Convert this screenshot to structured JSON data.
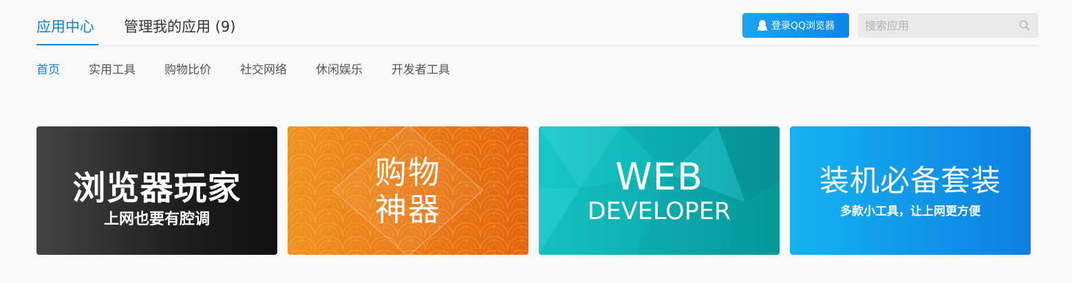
{
  "header": {
    "tabs": [
      {
        "label": "应用中心",
        "active": true
      },
      {
        "label": "管理我的应用 (9)",
        "active": false
      }
    ],
    "login_button": {
      "label": "登录QQ浏览器",
      "icon": "qq-penguin-icon"
    },
    "search": {
      "placeholder": "搜索应用",
      "value": "",
      "icon": "search-icon"
    }
  },
  "categories": [
    {
      "label": "首页",
      "active": true
    },
    {
      "label": "实用工具",
      "active": false
    },
    {
      "label": "购物比价",
      "active": false
    },
    {
      "label": "社交网络",
      "active": false
    },
    {
      "label": "休闲娱乐",
      "active": false
    },
    {
      "label": "开发者工具",
      "active": false
    }
  ],
  "banners": [
    {
      "title": "浏览器玩家",
      "subtitle": "上网也要有腔调",
      "theme": "dark"
    },
    {
      "title": "购物",
      "subtitle": "神器",
      "theme": "orange"
    },
    {
      "title": "WEB",
      "subtitle": "DEVELOPER",
      "theme": "teal"
    },
    {
      "title": "装机必备套装",
      "subtitle": "多款小工具，让上网更方便",
      "theme": "blue"
    }
  ],
  "colors": {
    "accent": "#0a86d8",
    "page_background": "#f9f9f9",
    "login_button": "#0b86e6",
    "banner_dark": "#1e1e1e",
    "banner_orange": "#e97a14",
    "banner_teal": "#0cb6b8",
    "banner_blue": "#0f96ea"
  }
}
